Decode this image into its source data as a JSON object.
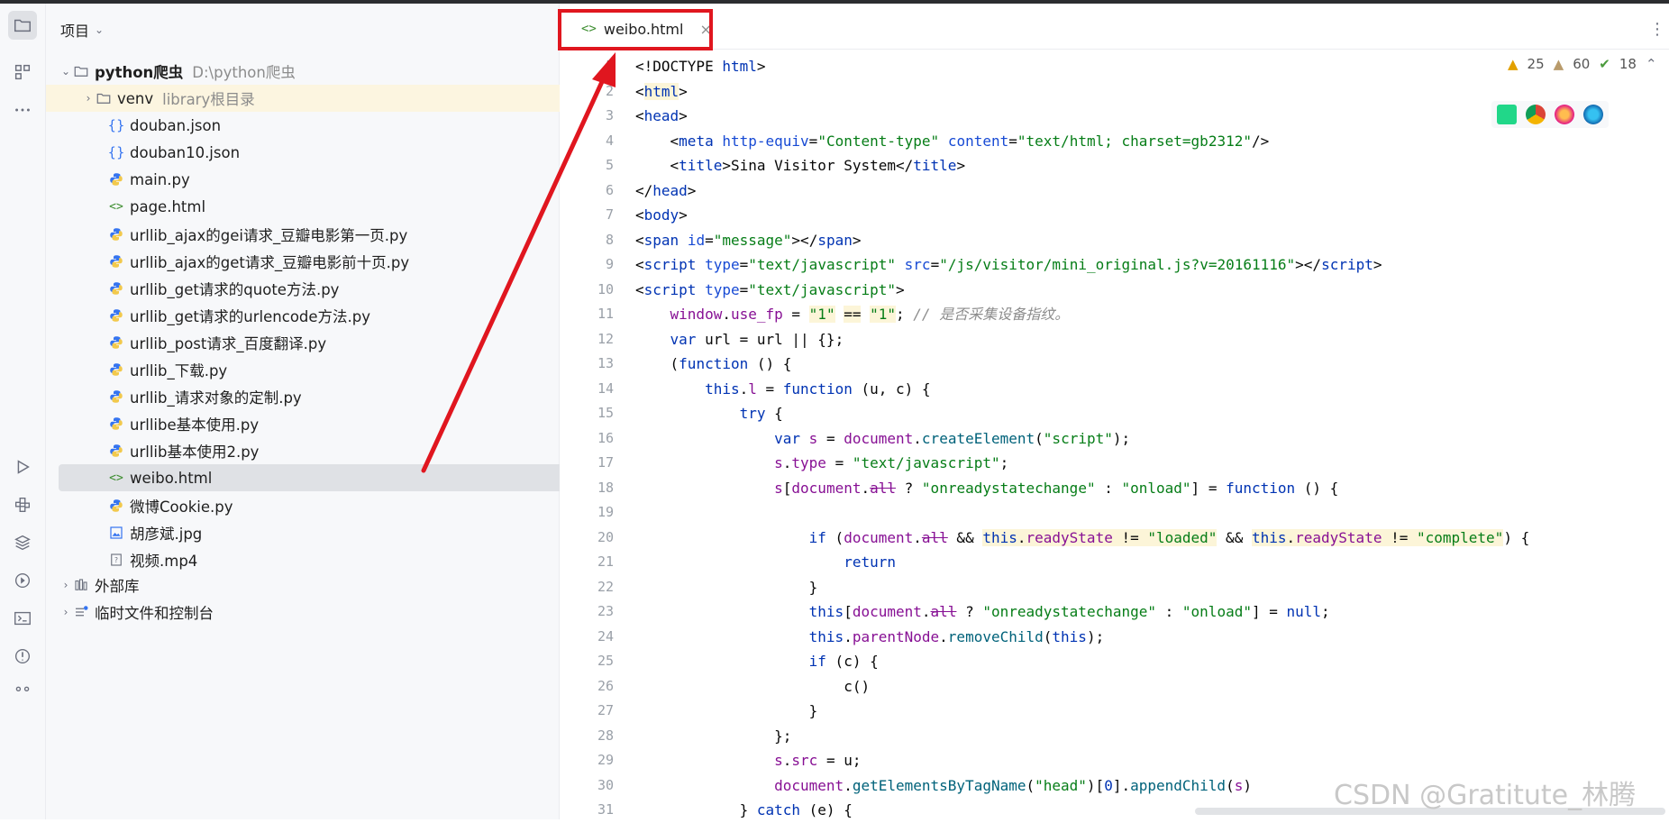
{
  "project_panel": {
    "title": "项目",
    "root": {
      "name": "python爬虫",
      "path": "D:\\python爬虫"
    },
    "items": [
      {
        "name": "venv",
        "note": "library根目录",
        "type": "folder"
      },
      {
        "name": "douban.json",
        "type": "json"
      },
      {
        "name": "douban10.json",
        "type": "json"
      },
      {
        "name": "main.py",
        "type": "py"
      },
      {
        "name": "page.html",
        "type": "html"
      },
      {
        "name": "urllib_ajax的gei请求_豆瓣电影第一页.py",
        "type": "py"
      },
      {
        "name": "urllib_ajax的get请求_豆瓣电影前十页.py",
        "type": "py"
      },
      {
        "name": "urllib_get请求的quote方法.py",
        "type": "py"
      },
      {
        "name": "urllib_get请求的urlencode方法.py",
        "type": "py"
      },
      {
        "name": "urllib_post请求_百度翻译.py",
        "type": "py"
      },
      {
        "name": "urllib_下载.py",
        "type": "py"
      },
      {
        "name": "urllib_请求对象的定制.py",
        "type": "py"
      },
      {
        "name": "urllibe基本使用.py",
        "type": "py"
      },
      {
        "name": "urllib基本使用2.py",
        "type": "py"
      },
      {
        "name": "weibo.html",
        "type": "html"
      },
      {
        "name": "微博Cookie.py",
        "type": "py"
      },
      {
        "name": "胡彦斌.jpg",
        "type": "img"
      },
      {
        "name": "视频.mp4",
        "type": "unknown"
      }
    ],
    "external_libs": "外部库",
    "scratches": "临时文件和控制台"
  },
  "editor": {
    "tab_label": "weibo.html",
    "inspections": {
      "warnings_a": "25",
      "warnings_b": "60",
      "ok": "18"
    },
    "line_numbers": [
      "1",
      "2",
      "3",
      "4",
      "5",
      "6",
      "7",
      "8",
      "9",
      "10",
      "11",
      "12",
      "13",
      "14",
      "15",
      "16",
      "17",
      "18",
      "19",
      "20",
      "21",
      "22",
      "23",
      "24",
      "25",
      "26",
      "27",
      "28",
      "29",
      "30",
      "31"
    ]
  },
  "watermark": "CSDN @Gratitute_林腾",
  "colors": {
    "red_annotation": "#e0161f",
    "selection": "#dfe1e5",
    "highlight_row": "#fcf5e0"
  }
}
